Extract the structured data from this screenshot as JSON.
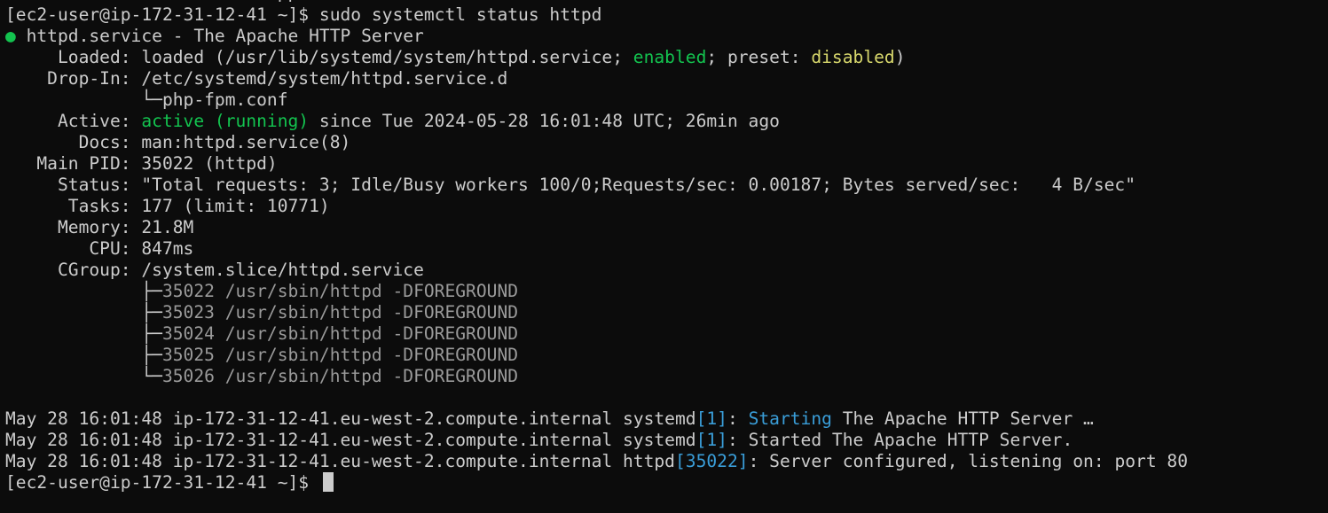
{
  "top_fragment": "                          pp ",
  "prompt": "[ec2-user@ip-172-31-12-41 ~]$ ",
  "command": "sudo systemctl status httpd",
  "service": {
    "bullet": "●",
    "header": " httpd.service - The Apache HTTP Server"
  },
  "loaded": {
    "label": "     Loaded: ",
    "value_before": "loaded (/usr/lib/systemd/system/httpd.service; ",
    "enabled": "enabled",
    "value_mid": "; preset: ",
    "preset": "disabled",
    "value_after": ")"
  },
  "dropin": {
    "label": "    Drop-In: ",
    "path": "/etc/systemd/system/httpd.service.d",
    "tree_prefix": "             └─",
    "file": "php-fpm.conf"
  },
  "active": {
    "label": "     Active: ",
    "state": "active (running)",
    "since": " since Tue 2024-05-28 16:01:48 UTC; 26min ago"
  },
  "docs": {
    "label": "       Docs: ",
    "value": "man:httpd.service(8)"
  },
  "main_pid": {
    "label": "   Main PID: ",
    "value": "35022 (httpd)"
  },
  "status": {
    "label": "     Status: ",
    "value": "\"Total requests: 3; Idle/Busy workers 100/0;Requests/sec: 0.00187; Bytes served/sec:   4 B/sec\""
  },
  "tasks": {
    "label": "      Tasks: ",
    "value": "177 (limit: 10771)"
  },
  "memory": {
    "label": "     Memory: ",
    "value": "21.8M"
  },
  "cpu": {
    "label": "        CPU: ",
    "value": "847ms"
  },
  "cgroup": {
    "label": "     CGroup: ",
    "value": "/system.slice/httpd.service",
    "processes": [
      {
        "prefix": "             ├─",
        "text": "35022 /usr/sbin/httpd -DFOREGROUND"
      },
      {
        "prefix": "             ├─",
        "text": "35023 /usr/sbin/httpd -DFOREGROUND"
      },
      {
        "prefix": "             ├─",
        "text": "35024 /usr/sbin/httpd -DFOREGROUND"
      },
      {
        "prefix": "             ├─",
        "text": "35025 /usr/sbin/httpd -DFOREGROUND"
      },
      {
        "prefix": "             └─",
        "text": "35026 /usr/sbin/httpd -DFOREGROUND"
      }
    ]
  },
  "logs": [
    {
      "prefix": "May 28 16:01:48 ip-172-31-12-41.eu-west-2.compute.internal systemd",
      "bracket": "[1]",
      "sep": ": ",
      "highlight": "Starting",
      "rest": " The Apache HTTP Server …"
    },
    {
      "prefix": "May 28 16:01:48 ip-172-31-12-41.eu-west-2.compute.internal systemd",
      "bracket": "[1]",
      "sep": ": ",
      "highlight": "",
      "rest": "Started The Apache HTTP Server."
    },
    {
      "prefix": "May 28 16:01:48 ip-172-31-12-41.eu-west-2.compute.internal httpd",
      "bracket": "[35022]",
      "sep": ": ",
      "highlight": "",
      "rest": "Server configured, listening on: port 80"
    }
  ],
  "final_prompt": "[ec2-user@ip-172-31-12-41 ~]$ ",
  "colors": {
    "background": "#0c0c0c",
    "text": "#cccccc",
    "green": "#13c34f",
    "yellow": "#d7d76c",
    "gray": "#9a9a9a",
    "blue": "#3a9ed9"
  }
}
